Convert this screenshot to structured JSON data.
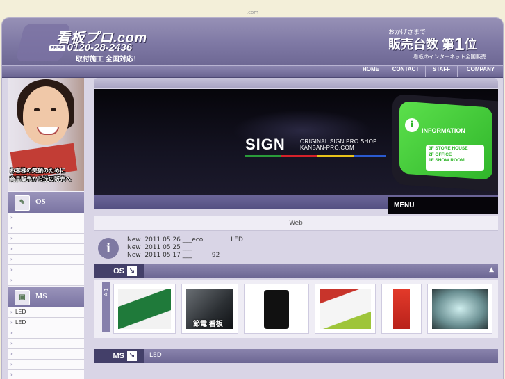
{
  "domain_note": ".com",
  "header": {
    "logo_title": "看板プロ.com",
    "phone_tag": "FREE",
    "phone": "0120-28-2436",
    "logo_sub": "取付施工 全国対応！",
    "rank_small": "おかげさまで",
    "rank_main": "販売台数 第",
    "rank_num": "1",
    "rank_suffix": "位",
    "rank_note": "看板のインターネット全国販売"
  },
  "nav": {
    "items": [
      "HOME",
      "CONTACT",
      "STAFF",
      "COMPANY"
    ]
  },
  "sidebar": {
    "photo_caption_1": "お客様の笑顔のために",
    "photo_caption_2": "商品販売から技の販売へ",
    "os_section": {
      "title": "OS",
      "icon": "os-icon",
      "items": [
        "",
        "",
        "",
        "",
        "",
        "",
        ""
      ]
    },
    "ms_section": {
      "title": "MS",
      "icon": "ms-icon",
      "items": [
        "LED",
        "LED",
        "",
        "",
        "",
        "",
        ""
      ]
    }
  },
  "hero": {
    "sign_word": "SIGN",
    "line1": "ORIGINAL SIGN PRO SHOP",
    "line2": "KANBAN-PRO.COM",
    "info_title": "INFORMATION",
    "info_lines": [
      "3F  STORE HOUSE",
      "2F  OFFICE",
      "1F  SHOW ROOM"
    ],
    "menu_label": "MENU",
    "stripe_colors": [
      "#2a9a3a",
      "#d4222a",
      "#e8c21a",
      "#2a5ad0"
    ]
  },
  "web_bar": "Web",
  "news": [
    "New  2011 05 26 ___eco              LED",
    "New  2011 05 25 ___",
    "New  2011 05 17 ___          92"
  ],
  "os_strip": {
    "label": "OS",
    "arrow": "↘",
    "up": "▲"
  },
  "products": {
    "side_label": "A-1",
    "items": [
      {
        "name": "product-street-sign",
        "caption": ""
      },
      {
        "name": "product-lcd-sign",
        "caption": "節電 看板"
      },
      {
        "name": "product-black-stand",
        "caption": ""
      },
      {
        "name": "product-panel-sign",
        "caption": ""
      },
      {
        "name": "product-banner-flag",
        "caption": ""
      },
      {
        "name": "product-glass-letters",
        "caption": ""
      }
    ]
  },
  "ms_strip": {
    "label": "MS",
    "arrow": "↘",
    "text": "LED"
  }
}
